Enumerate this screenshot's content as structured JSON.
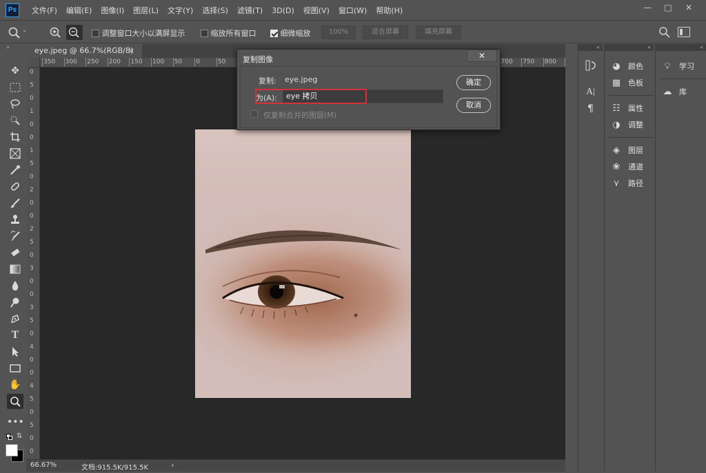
{
  "app": {
    "logo": "Ps"
  },
  "menu": [
    "文件(F)",
    "编辑(E)",
    "图像(I)",
    "图层(L)",
    "文字(Y)",
    "选择(S)",
    "滤镜(T)",
    "3D(D)",
    "视图(V)",
    "窗口(W)",
    "帮助(H)"
  ],
  "window_controls": {
    "minimize": "—",
    "maximize": "□",
    "close": "✕"
  },
  "options": {
    "resize_windows_label": "调整窗口大小以满屏显示",
    "resize_windows_checked": false,
    "zoom_all_label": "缩放所有窗口",
    "zoom_all_checked": false,
    "scrubby_zoom_label": "细微缩放",
    "scrubby_zoom_checked": true,
    "zoom_100": "100%",
    "fit_screen": "适合屏幕",
    "fill_screen": "填充屏幕"
  },
  "document": {
    "tab_title": "eye.jpeg @ 66.7%(RGB/8)",
    "close": "×"
  },
  "ruler": {
    "h_ticks": [
      "350",
      "300",
      "250",
      "200",
      "150",
      "100",
      "50",
      "0",
      "50",
      "100",
      "150",
      "200",
      "250",
      "300",
      "350",
      "400",
      "450",
      "500",
      "550",
      "600",
      "650",
      "700",
      "750",
      "800",
      "850"
    ],
    "v_ticks": [
      "0",
      "5",
      "0",
      "1",
      "0",
      "0",
      "1",
      "5",
      "0",
      "2",
      "0",
      "0",
      "2",
      "5",
      "0",
      "3",
      "0",
      "0",
      "3",
      "5",
      "0",
      "4",
      "0",
      "0",
      "4",
      "5",
      "0",
      "5",
      "0",
      "0"
    ]
  },
  "status": {
    "zoom": "66.67%",
    "doc_size": "文档:915.5K/915.5K",
    "arrow": "›"
  },
  "panels": {
    "group2": [
      {
        "icon": "palette-icon",
        "label": "颜色"
      },
      {
        "icon": "swatches-icon",
        "label": "色板"
      },
      {
        "icon": "properties-icon",
        "label": "属性"
      },
      {
        "icon": "adjustments-icon",
        "label": "调整"
      },
      {
        "icon": "layers-icon",
        "label": "图层"
      },
      {
        "icon": "channels-icon",
        "label": "通道"
      },
      {
        "icon": "paths-icon",
        "label": "路径"
      }
    ],
    "group3": [
      {
        "icon": "learn-icon",
        "label": "学习"
      },
      {
        "icon": "libraries-icon",
        "label": "库"
      }
    ]
  },
  "dialog": {
    "title": "复制图像",
    "source_label": "复制:",
    "source_value": "eye.jpeg",
    "as_label": "为(A):",
    "as_value": "eye 拷贝",
    "merged_label": "仅复制合并的图层(M)",
    "merged_checked": false,
    "ok": "确定",
    "cancel": "取消",
    "close": "✕"
  },
  "colors": {
    "highlight": "#d4313a",
    "canvas_bg": "#282828",
    "ui_bg": "#535353"
  }
}
